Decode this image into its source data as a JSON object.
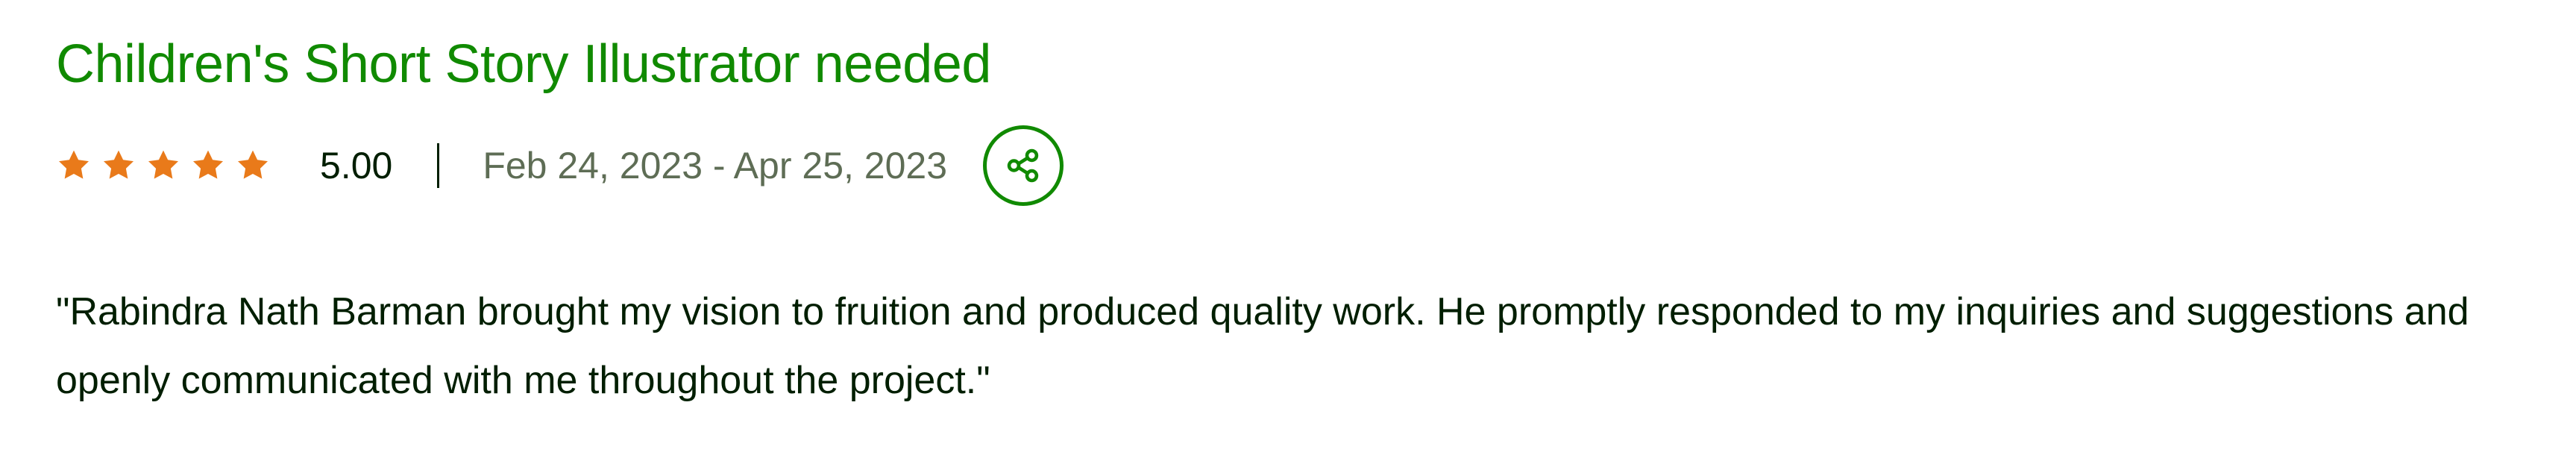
{
  "review": {
    "title": "Children's Short Story Illustrator needed",
    "rating": "5.00",
    "star_count": 5,
    "date_range": "Feb 24, 2023 - Apr 25, 2023",
    "quote": "\"Rabindra Nath Barman brought my vision to fruition and produced quality work. He promptly responded to my inquiries and suggestions and openly communicated with me throughout the project.\""
  },
  "icons": {
    "star": "star-icon",
    "share": "share-icon"
  },
  "colors": {
    "title": "#108a00",
    "star": "#e97a1a",
    "text": "#001e00",
    "muted": "#5e6d55",
    "share_border": "#108a00"
  }
}
